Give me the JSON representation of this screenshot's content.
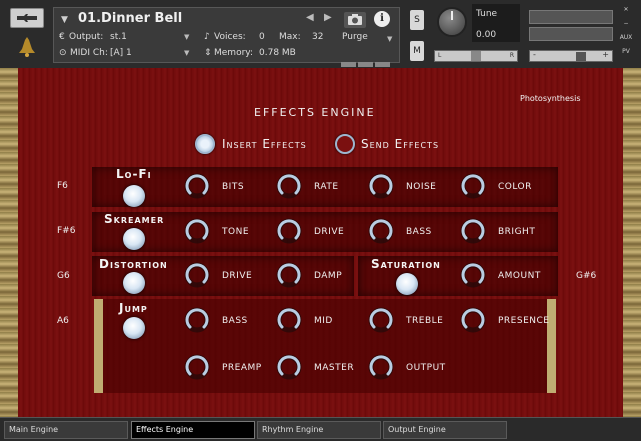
{
  "header": {
    "instrument_name": "01.Dinner Bell",
    "output_label": "Output:",
    "output_value": "st.1",
    "voices_label": "Voices:",
    "voices_value": "0",
    "max_label": "Max:",
    "max_value": "32",
    "purge_label": "Purge",
    "midi_label": "MIDI Ch:",
    "midi_value": "[A] 1",
    "memory_label": "Memory:",
    "memory_value": "0.78 MB",
    "solo_label": "S",
    "mute_label": "M",
    "tune_label": "Tune",
    "tune_value": "0.00",
    "pan_left": "L",
    "pan_right": "R",
    "vol_minus": "-",
    "vol_plus": "+",
    "aux_label": "AUX",
    "pv_label": "PV"
  },
  "panel": {
    "title": "EFFECTS ENGINE",
    "brand": "Photosynthesis",
    "insert_label": "Insert Effects",
    "send_label": "Send Effects",
    "insert_selected": true
  },
  "rows": [
    {
      "key": "F6",
      "name": "Lo-Fi",
      "params": [
        "BITS",
        "RATE",
        "NOISE",
        "COLOR"
      ]
    },
    {
      "key": "F#6",
      "name": "Skreamer",
      "params": [
        "TONE",
        "DRIVE",
        "BASS",
        "BRIGHT"
      ]
    },
    {
      "key": "G6",
      "name": "Distortion",
      "params": [
        "DRIVE",
        "DAMP"
      ],
      "extra_name": "Saturation",
      "extra_params": [
        "AMOUNT"
      ],
      "extra_key": "G#6"
    },
    {
      "key": "A6",
      "name": "Jump",
      "params": [
        "BASS",
        "MID",
        "TREBLE",
        "PRESENCE"
      ],
      "params2": [
        "PREAMP",
        "MASTER",
        "OUTPUT"
      ]
    }
  ],
  "tabs": [
    {
      "label": "Main Engine",
      "active": false
    },
    {
      "label": "Effects Engine",
      "active": true
    },
    {
      "label": "Rhythm Engine",
      "active": false
    },
    {
      "label": "Output Engine",
      "active": false
    }
  ]
}
